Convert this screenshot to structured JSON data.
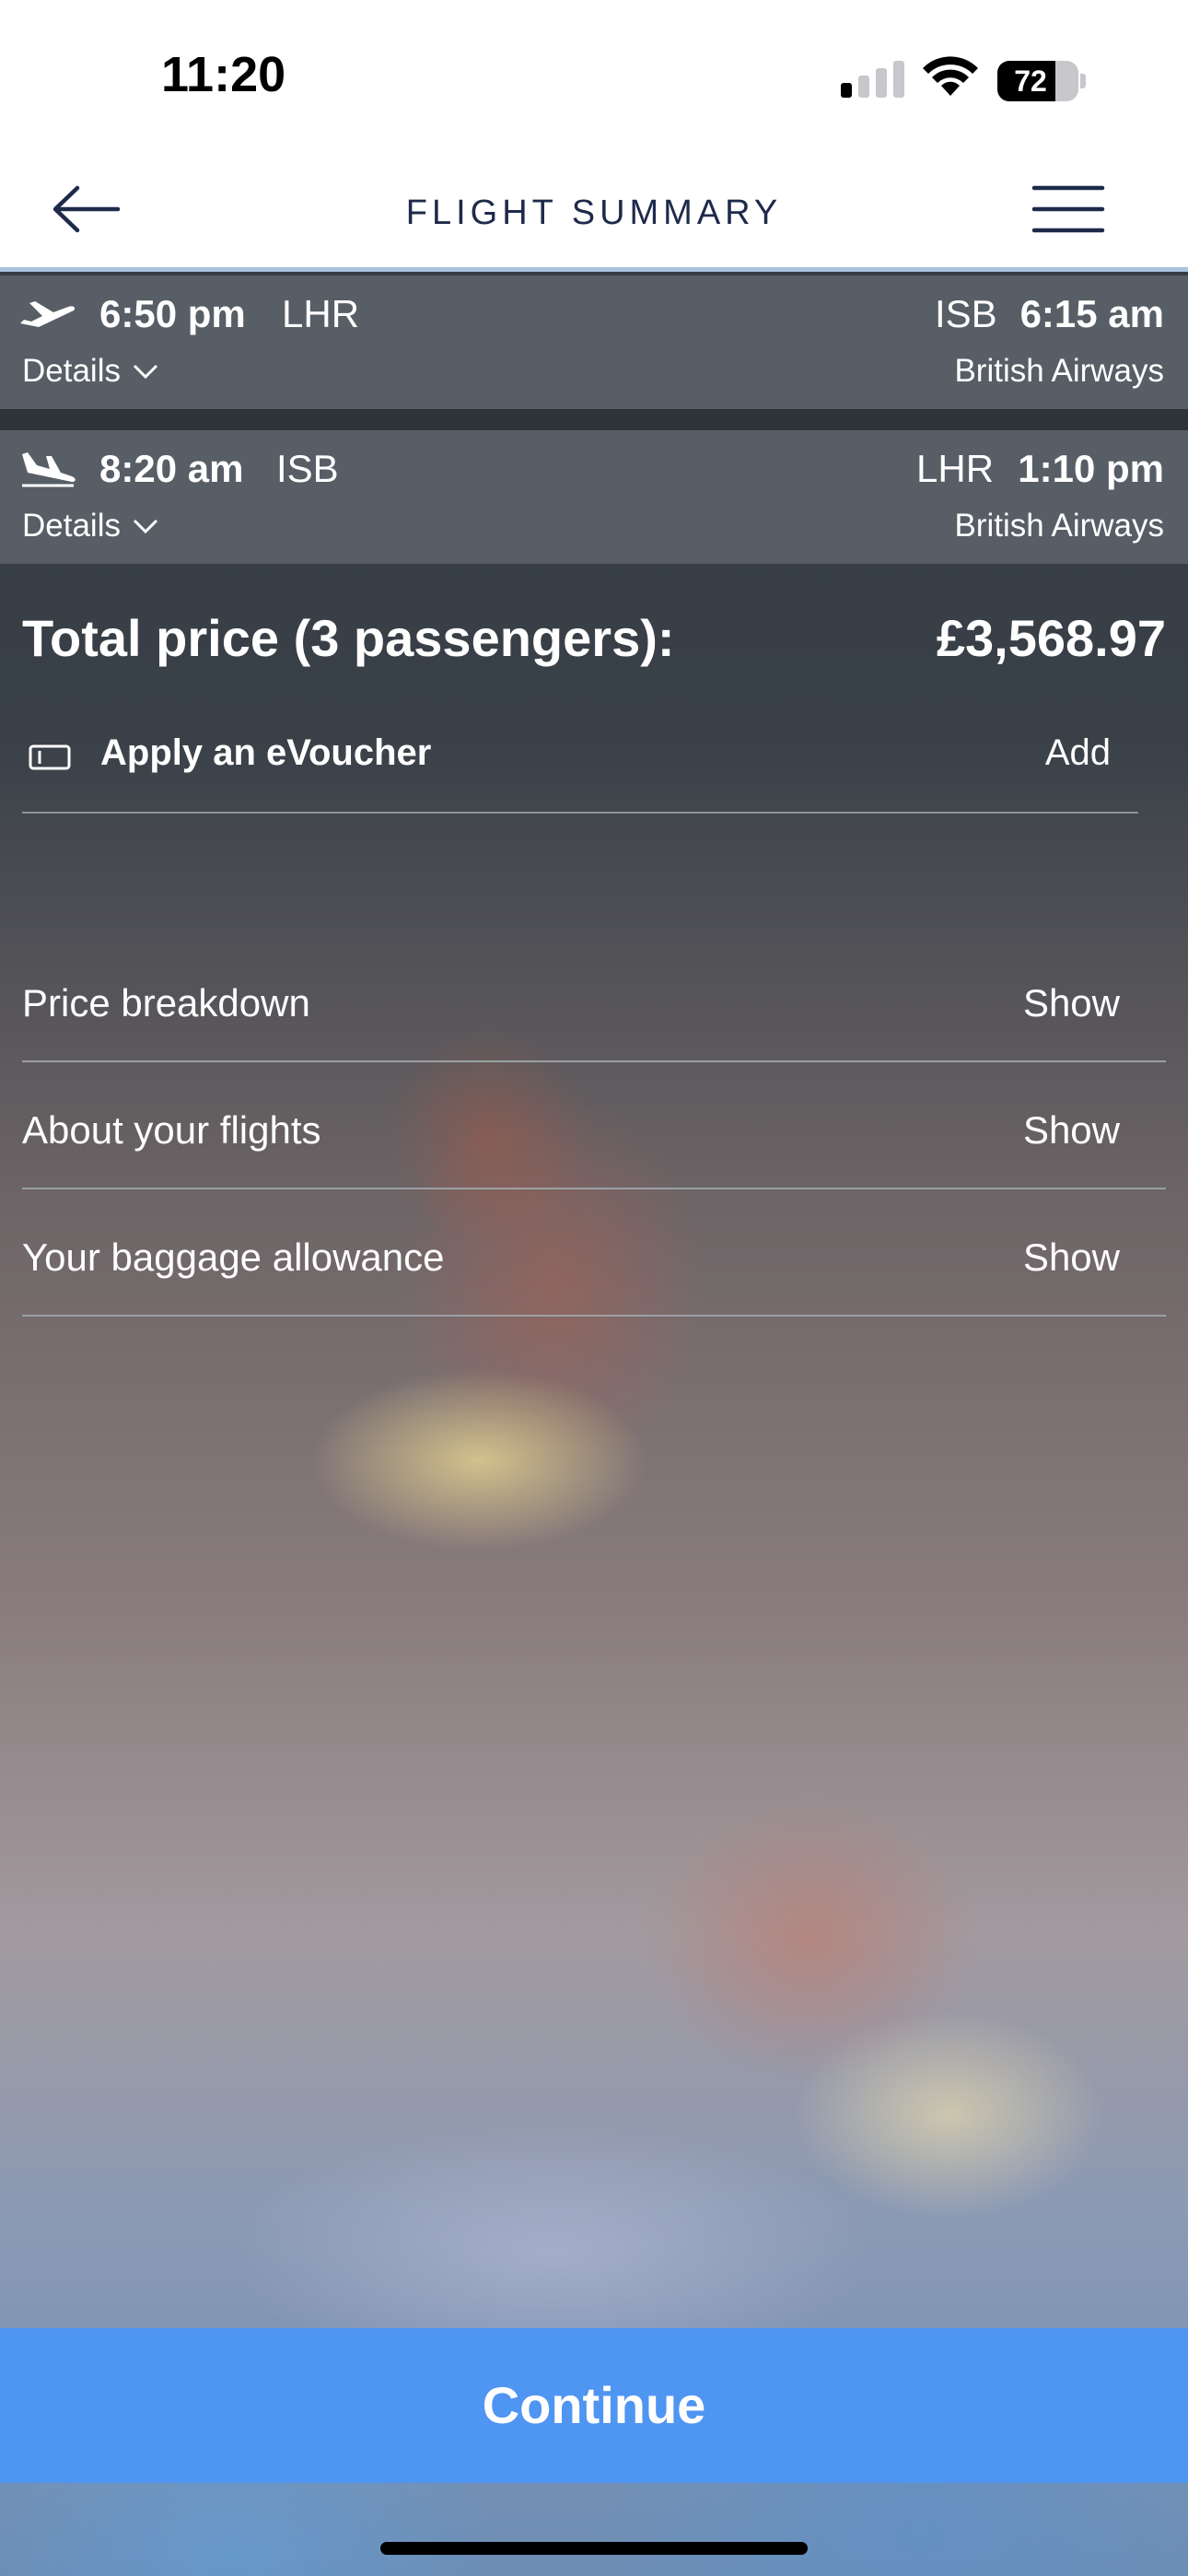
{
  "status_bar": {
    "time": "11:20",
    "battery_level": "72",
    "battery_fraction": 0.72
  },
  "header": {
    "title": "FLIGHT SUMMARY",
    "back_icon": "arrow-left-icon",
    "menu_icon": "hamburger-menu-icon"
  },
  "flights": [
    {
      "direction": "outbound",
      "icon": "plane-takeoff-icon",
      "departure_time": "6:50 pm",
      "departure_code": "LHR",
      "arrival_code": "ISB",
      "arrival_time": "6:15 am",
      "details_label": "Details",
      "airline": "British Airways"
    },
    {
      "direction": "return",
      "icon": "plane-landing-icon",
      "departure_time": "8:20 am",
      "departure_code": "ISB",
      "arrival_code": "LHR",
      "arrival_time": "1:10 pm",
      "details_label": "Details",
      "airline": "British Airways"
    }
  ],
  "total": {
    "label": "Total price (3 passengers):",
    "value": "£3,568.97"
  },
  "voucher": {
    "icon": "ticket-icon",
    "label": "Apply an eVoucher",
    "action": "Add"
  },
  "accordion": [
    {
      "label": "Price breakdown",
      "action": "Show"
    },
    {
      "label": "About your flights",
      "action": "Show"
    },
    {
      "label": "Your baggage allowance",
      "action": "Show"
    }
  ],
  "continue_label": "Continue",
  "colors": {
    "accent": "#4f95f2",
    "header_text": "#1e2a4a",
    "flight_row_bg": "#575e65"
  }
}
